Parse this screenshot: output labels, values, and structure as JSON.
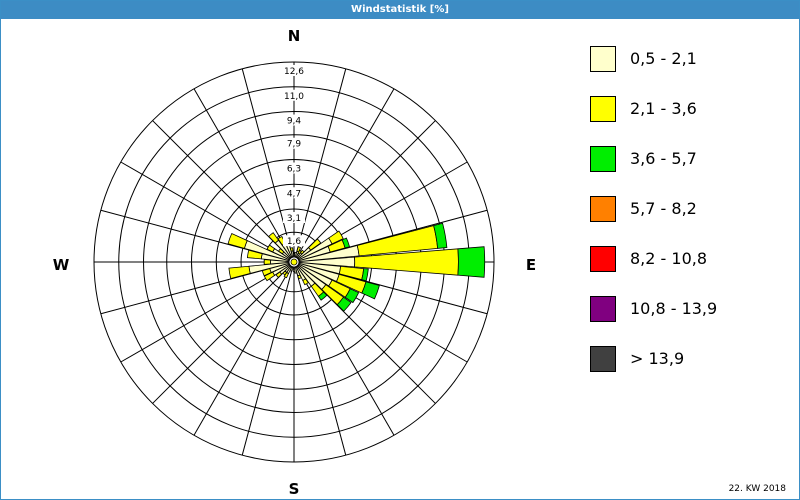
{
  "window": {
    "title": "Windstatistik [%]"
  },
  "footnote": "22. KW 2018",
  "chart_data": {
    "type": "wind-rose",
    "title": "Windstatistik [%]",
    "directions": 36,
    "radial_max": 12.6,
    "ring_labels": [
      "1,6",
      "3,1",
      "4,7",
      "6,3",
      "7,9",
      "9,4",
      "11,0",
      "12,6"
    ],
    "ring_values": [
      1.6,
      3.1,
      4.7,
      6.3,
      7.9,
      9.4,
      11.0,
      12.6
    ],
    "compass": {
      "n": "N",
      "e": "E",
      "s": "S",
      "w": "W"
    },
    "bins": [
      {
        "label": "0,5 - 2,1",
        "color": "#ffffcc"
      },
      {
        "label": "2,1 - 3,6",
        "color": "#ffff00"
      },
      {
        "label": "3,6 - 5,7",
        "color": "#00ee00"
      },
      {
        "label": "5,7 - 8,2",
        "color": "#ff8000"
      },
      {
        "label": "8,2 - 10,8",
        "color": "#ff0000"
      },
      {
        "label": "10,8 - 13,9",
        "color": "#800080"
      },
      {
        "label": "> 13,9",
        "color": "#404040"
      }
    ],
    "sectors": [
      {
        "dir": 0,
        "values": [
          0.2,
          0.0,
          0,
          0,
          0,
          0,
          0
        ]
      },
      {
        "dir": 10,
        "values": [
          0.3,
          0.0,
          0,
          0,
          0,
          0,
          0
        ]
      },
      {
        "dir": 20,
        "values": [
          0.4,
          0.3,
          0,
          0,
          0,
          0,
          0
        ]
      },
      {
        "dir": 30,
        "values": [
          0.3,
          0.2,
          0,
          0,
          0,
          0,
          0
        ]
      },
      {
        "dir": 40,
        "values": [
          0.4,
          0.2,
          0,
          0,
          0,
          0,
          0
        ]
      },
      {
        "dir": 50,
        "values": [
          1.0,
          0.8,
          0,
          0,
          0,
          0,
          0
        ]
      },
      {
        "dir": 60,
        "values": [
          2.4,
          0.8,
          0,
          0,
          0,
          0,
          0
        ]
      },
      {
        "dir": 70,
        "values": [
          2.1,
          1.0,
          0.3,
          0,
          0,
          0,
          0
        ]
      },
      {
        "dir": 80,
        "values": [
          3.9,
          5.1,
          0.6,
          0,
          0,
          0,
          0
        ]
      },
      {
        "dir": 90,
        "values": [
          3.6,
          6.7,
          1.7,
          0,
          0,
          0,
          0
        ]
      },
      {
        "dir": 100,
        "values": [
          2.7,
          1.5,
          0.3,
          0,
          0,
          0,
          0
        ]
      },
      {
        "dir": 110,
        "values": [
          2.7,
          1.8,
          0.9,
          0,
          0,
          0,
          0
        ]
      },
      {
        "dir": 120,
        "values": [
          2.4,
          1.3,
          0.6,
          0,
          0,
          0,
          0
        ]
      },
      {
        "dir": 130,
        "values": [
          2.2,
          1.4,
          0.6,
          0,
          0,
          0,
          0
        ]
      },
      {
        "dir": 140,
        "values": [
          1.6,
          0.8,
          0.3,
          0,
          0,
          0,
          0
        ]
      },
      {
        "dir": 150,
        "values": [
          1.0,
          0.3,
          0,
          0,
          0,
          0,
          0
        ]
      },
      {
        "dir": 160,
        "values": [
          0.6,
          0.2,
          0,
          0,
          0,
          0,
          0
        ]
      },
      {
        "dir": 170,
        "values": [
          0.4,
          0.0,
          0,
          0,
          0,
          0,
          0
        ]
      },
      {
        "dir": 180,
        "values": [
          0.3,
          0.0,
          0,
          0,
          0,
          0,
          0
        ]
      },
      {
        "dir": 190,
        "values": [
          0.2,
          0.0,
          0,
          0,
          0,
          0,
          0
        ]
      },
      {
        "dir": 200,
        "values": [
          0.3,
          0.0,
          0,
          0,
          0,
          0,
          0
        ]
      },
      {
        "dir": 210,
        "values": [
          0.5,
          0.3,
          0,
          0,
          0,
          0,
          0
        ]
      },
      {
        "dir": 220,
        "values": [
          0.5,
          0.2,
          0,
          0,
          0,
          0,
          0
        ]
      },
      {
        "dir": 230,
        "values": [
          0.8,
          0.3,
          0,
          0,
          0,
          0,
          0
        ]
      },
      {
        "dir": 240,
        "values": [
          1.2,
          0.6,
          0,
          0,
          0,
          0,
          0
        ]
      },
      {
        "dir": 250,
        "values": [
          1.3,
          0.5,
          0,
          0,
          0,
          0,
          0
        ]
      },
      {
        "dir": 260,
        "values": [
          2.6,
          1.3,
          0,
          0,
          0,
          0,
          0
        ]
      },
      {
        "dir": 270,
        "values": [
          1.2,
          0.4,
          0,
          0,
          0,
          0,
          0
        ]
      },
      {
        "dir": 280,
        "values": [
          1.8,
          0.9,
          0,
          0,
          0,
          0,
          0
        ]
      },
      {
        "dir": 290,
        "values": [
          3.0,
          1.1,
          0,
          0,
          0,
          0,
          0
        ]
      },
      {
        "dir": 300,
        "values": [
          1.2,
          0.4,
          0,
          0,
          0,
          0,
          0
        ]
      },
      {
        "dir": 310,
        "values": [
          0.6,
          0.3,
          0,
          0,
          0,
          0,
          0
        ]
      },
      {
        "dir": 320,
        "values": [
          1.4,
          0.6,
          0,
          0,
          0,
          0,
          0
        ]
      },
      {
        "dir": 330,
        "values": [
          1.0,
          0.5,
          0,
          0,
          0,
          0,
          0
        ]
      },
      {
        "dir": 340,
        "values": [
          0.8,
          0.4,
          0,
          0,
          0,
          0,
          0
        ]
      },
      {
        "dir": 350,
        "values": [
          0.4,
          0.2,
          0,
          0,
          0,
          0,
          0
        ]
      }
    ]
  }
}
